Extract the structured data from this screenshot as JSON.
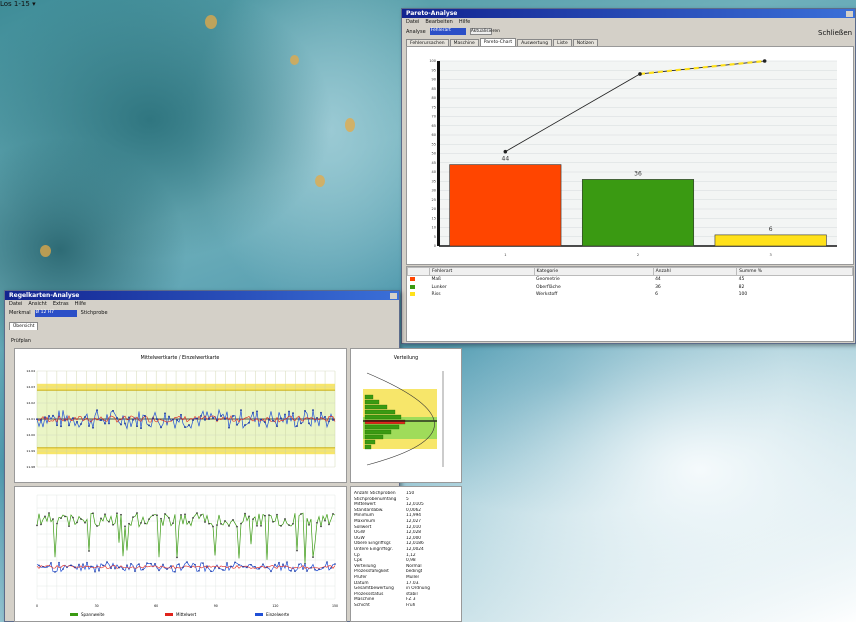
{
  "pareto_window": {
    "title": "Pareto-Analyse",
    "menu": [
      "Datei",
      "Bearbeiten",
      "Hilfe"
    ],
    "toolbar": {
      "label": "Analyse",
      "select_value": "Fehlerart",
      "button": "Aktualisieren"
    },
    "right_button": "Schließen",
    "tabs": [
      "Fehlerursachen",
      "Maschine",
      "Pareto-Chart",
      "Auswertung",
      "Liste",
      "Notizen"
    ],
    "table": {
      "headers": [
        "Fehlerart",
        "Kategorie",
        "Anzahl",
        "Summe %"
      ],
      "rows": [
        {
          "color": "#ff4500",
          "cells": [
            "Maß",
            "Geometrie",
            "44",
            "45"
          ]
        },
        {
          "color": "#3a9a12",
          "cells": [
            "Lunker",
            "Oberfläche",
            "36",
            "82"
          ]
        },
        {
          "color": "#ffe11a",
          "cells": [
            "Riss",
            "Werkstoff",
            "6",
            "100"
          ]
        }
      ]
    }
  },
  "spc_window": {
    "title": "Regelkarten-Analyse",
    "menu": [
      "Datei",
      "Ansicht",
      "Extras",
      "Hilfe"
    ],
    "toolbar": {
      "label": "Merkmal",
      "input_value": "Ø 12 H7",
      "status": "Stichprobe"
    },
    "subtab": "Übersicht",
    "filter_label": "Prüfplan",
    "filter_value": "Los 1-15",
    "main_chart_title": "Mittelwertkarte / Einzelwertkarte",
    "hist_title": "Verteilung",
    "legend": [
      "Spannweite",
      "Mittelwert",
      "Einzelwerte"
    ],
    "info_rows": [
      [
        "Anzahl Stichproben",
        "150"
      ],
      [
        "Stichprobenumfang",
        "5"
      ],
      [
        "Mittelwert",
        "12,0105"
      ],
      [
        "Standardabw.",
        "0,0062"
      ],
      [
        "Minimum",
        "11,994"
      ],
      [
        "Maximum",
        "12,027"
      ],
      [
        "Sollwert",
        "12,010"
      ],
      [
        "OGW",
        "12,028"
      ],
      [
        "UGW",
        "12,000"
      ],
      [
        "Obere Eingriffsgr.",
        "12,0186"
      ],
      [
        "Untere Eingriffsgr.",
        "12,0024"
      ],
      [
        "Cp",
        "1,12"
      ],
      [
        "Cpk",
        "0,98"
      ],
      [
        "Verteilung",
        "Normal"
      ],
      [
        "Prozessfähigkeit",
        "bedingt"
      ],
      [
        "Prüfer",
        "Müller"
      ],
      [
        "Datum",
        "17.03."
      ],
      [
        "",
        ""
      ],
      [
        "Gesamtbewertung",
        "in Ordnung"
      ],
      [
        "Prozessstatus",
        "stabil"
      ],
      [
        "Maschine",
        "FZ 3"
      ],
      [
        "Schicht",
        "Früh"
      ]
    ]
  },
  "chart_data": [
    {
      "type": "bar",
      "categories": [
        "1",
        "2",
        "3"
      ],
      "values": [
        44,
        36,
        6
      ],
      "bar_colors": [
        "#ff4500",
        "#3a9a12",
        "#ffe11a"
      ],
      "data_labels": [
        "44",
        "36",
        "6"
      ],
      "cumulative_line": [
        51,
        93,
        100
      ],
      "ylim": [
        0,
        100
      ],
      "grid": true
    },
    {
      "type": "line",
      "name_mean": "x̄",
      "points": 150,
      "ylim": [
        11.98,
        12.04
      ],
      "center": 12.01,
      "upper_limit": 12.028,
      "lower_limit": 11.992,
      "zones": [
        "#f7e66a",
        "#eaf5c6",
        "#f7e66a"
      ],
      "grid": true
    }
  ]
}
